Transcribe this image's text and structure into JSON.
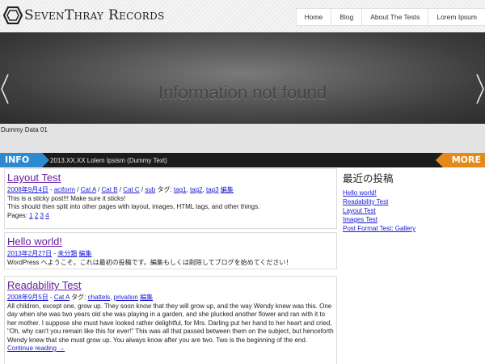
{
  "site": {
    "name": "SevenThray Records"
  },
  "nav": [
    "Home",
    "Blog",
    "About The Tests",
    "Lorem Ipsum"
  ],
  "slider": {
    "message": "Information not found",
    "caption": "Dummy Data 01"
  },
  "infobar": {
    "label": "INFO",
    "text": "2013.XX.XX Lolem Ipsism (Dummy Text)",
    "more": "MORE"
  },
  "posts": [
    {
      "title": "Layout Test",
      "date": "2008年9月4日",
      "sep": " - ",
      "author": "aciform",
      "slash": " / ",
      "categories": [
        "Cat A",
        "Cat B",
        "Cat C",
        "sub"
      ],
      "tags_label": " タグ: ",
      "tags": [
        "tag1",
        "tag2",
        "tag3"
      ],
      "edit": "編集",
      "body": [
        "This is a sticky post!!! Make sure it sticks!",
        "This should then split into other pages with layout, images, HTML tags, and other things."
      ],
      "pages_label": "Pages: ",
      "pages": [
        "1",
        "2",
        "3",
        "4"
      ]
    },
    {
      "title": "Hello world!",
      "date": "2013年2月27日",
      "sep": " - ",
      "category": "未分類",
      "edit": "編集",
      "body": "WordPress へようこそ。これは最初の投稿です。編集もしくは削除してブログを始めてください！"
    },
    {
      "title": "Readability Test",
      "date": "2008年9月5日",
      "sep": " - ",
      "category": "Cat A",
      "tags_label": " タグ: ",
      "tags": [
        "chattels",
        "privation"
      ],
      "edit": "編集",
      "body": "All children, except one, grow up. They soon know that they will grow up, and the way Wendy knew was this. One day when she was two years old she was playing in a garden, and she plucked another flower and ran with it to her mother. I suppose she must have looked rather delightful, for Mrs. Darling put her hand to her heart and cried, \"Oh, why can't you remain like this for ever!\" This was all that passed between them on the subject, but henceforth Wendy knew that she must grow up. You always know after you are two. Two is the beginning of the end.",
      "continue": "Continue reading →"
    }
  ],
  "sidebar": {
    "title": "最近の投稿",
    "links": [
      "Hello world!",
      "Readability Test",
      "Layout Test",
      "Images Test",
      "Post Format Test: Gallery"
    ]
  },
  "colors": {
    "info_blue": "#2d8ad0",
    "more_orange": "#e48a1c",
    "title_purple": "#6a1ea0",
    "link_blue": "#1a1ad6"
  }
}
